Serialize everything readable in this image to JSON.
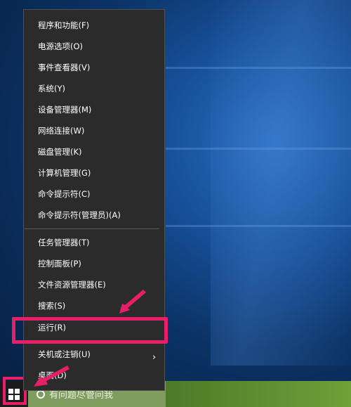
{
  "menu": {
    "items": [
      {
        "label": "程序和功能(F)"
      },
      {
        "label": "电源选项(O)"
      },
      {
        "label": "事件查看器(V)"
      },
      {
        "label": "系统(Y)"
      },
      {
        "label": "设备管理器(M)"
      },
      {
        "label": "网络连接(W)"
      },
      {
        "label": "磁盘管理(K)"
      },
      {
        "label": "计算机管理(G)"
      },
      {
        "label": "命令提示符(C)"
      },
      {
        "label": "命令提示符(管理员)(A)"
      },
      {
        "label": "任务管理器(T)"
      },
      {
        "label": "控制面板(P)"
      },
      {
        "label": "文件资源管理器(E)"
      },
      {
        "label": "搜索(S)"
      },
      {
        "label": "运行(R)"
      },
      {
        "label": "关机或注销(U)"
      },
      {
        "label": "桌面(D)"
      }
    ],
    "submenu_arrow": "›"
  },
  "taskbar": {
    "search_placeholder": "有问题尽管问我"
  },
  "colors": {
    "highlight": "#e61f68",
    "menu_bg": "#2b2b2b"
  },
  "icons": {
    "start": "windows-logo-icon",
    "search": "search-circle-icon",
    "submenu": "chevron-right-icon"
  }
}
